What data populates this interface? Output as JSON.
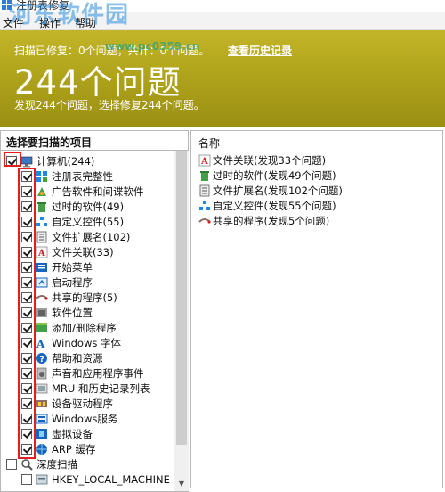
{
  "window": {
    "title": "注册表修复"
  },
  "watermark": {
    "text": "河东软件园",
    "url": "www.pc0359.cn"
  },
  "menu": [
    "文件",
    "操作",
    "帮助"
  ],
  "banner": {
    "summary": "扫描已修复：0个问题；共计：0个问题。",
    "history_link": "查看历史记录",
    "big_title": "244个问题",
    "subtitle": "发现244个问题，选择修复244个问题。",
    "colors": {
      "top": "#c3b52a",
      "bottom": "#9a8f12"
    }
  },
  "left_panel": {
    "header": "选择要扫描的项目",
    "root": {
      "label": "计算机(244)",
      "checked": true,
      "icon": "computer-icon"
    },
    "items": [
      {
        "label": "注册表完整性",
        "checked": true,
        "icon": "registry-icon"
      },
      {
        "label": "广告软件和间谍软件",
        "checked": true,
        "icon": "spyware-icon"
      },
      {
        "label": "过时的软件(49)",
        "checked": true,
        "icon": "trash-icon"
      },
      {
        "label": "自定义控件(55)",
        "checked": true,
        "icon": "controls-icon"
      },
      {
        "label": "文件扩展名(102)",
        "checked": true,
        "icon": "file-extension-icon"
      },
      {
        "label": "文件关联(33)",
        "checked": true,
        "icon": "file-association-icon"
      },
      {
        "label": "开始菜单",
        "checked": true,
        "icon": "start-menu-icon"
      },
      {
        "label": "启动程序",
        "checked": true,
        "icon": "startup-icon"
      },
      {
        "label": "共享的程序(5)",
        "checked": true,
        "icon": "shared-program-icon"
      },
      {
        "label": "软件位置",
        "checked": true,
        "icon": "software-location-icon"
      },
      {
        "label": "添加/删除程序",
        "checked": true,
        "icon": "add-remove-icon"
      },
      {
        "label": "Windows 字体",
        "checked": true,
        "icon": "fonts-icon"
      },
      {
        "label": "帮助和资源",
        "checked": true,
        "icon": "help-icon"
      },
      {
        "label": "声音和应用程序事件",
        "checked": true,
        "icon": "sound-icon"
      },
      {
        "label": "MRU 和历史记录列表",
        "checked": true,
        "icon": "history-icon"
      },
      {
        "label": "设备驱动程序",
        "checked": true,
        "icon": "driver-icon"
      },
      {
        "label": "Windows服务",
        "checked": true,
        "icon": "services-icon"
      },
      {
        "label": "虚拟设备",
        "checked": true,
        "icon": "virtual-device-icon"
      },
      {
        "label": "ARP 缓存",
        "checked": true,
        "icon": "arp-cache-icon"
      }
    ],
    "deep_scan": {
      "label": "深度扫描",
      "checked": false,
      "icon": "deep-scan-icon"
    },
    "deep_scan_items": [
      {
        "label": "HKEY_LOCAL_MACHINE",
        "checked": false,
        "icon": "registry-hive-icon"
      }
    ]
  },
  "right_panel": {
    "header": "名称",
    "results": [
      {
        "label": "文件关联(发现33个问题)",
        "icon": "file-association-icon"
      },
      {
        "label": "过时的软件(发现49个问题)",
        "icon": "trash-icon"
      },
      {
        "label": "文件扩展名(发现102个问题)",
        "icon": "file-extension-icon"
      },
      {
        "label": "自定义控件(发现55个问题)",
        "icon": "controls-icon"
      },
      {
        "label": "共享的程序(发现5个问题)",
        "icon": "shared-program-icon"
      }
    ]
  }
}
